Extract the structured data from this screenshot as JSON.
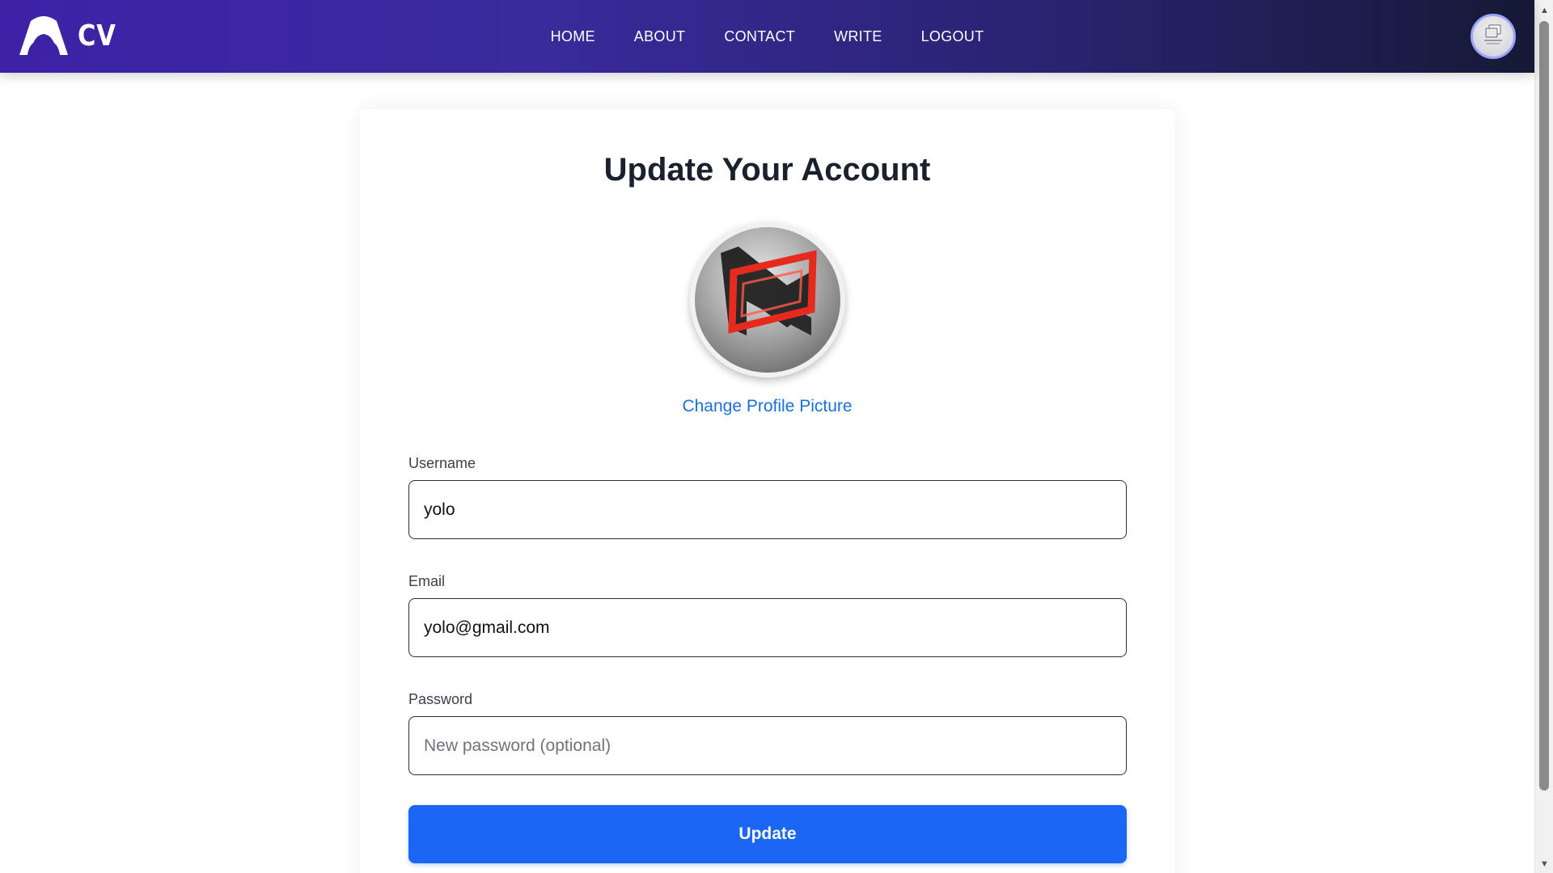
{
  "brand": {
    "name": "CV",
    "logo_icon": "arch-logo-icon"
  },
  "nav": {
    "items": [
      {
        "label": "HOME"
      },
      {
        "label": "ABOUT"
      },
      {
        "label": "CONTACT"
      },
      {
        "label": "WRITE"
      },
      {
        "label": "LOGOUT"
      }
    ],
    "avatar_icon": "no-image-avatar-icon"
  },
  "form": {
    "title": "Update Your Account",
    "change_picture_label": "Change Profile Picture",
    "username": {
      "label": "Username",
      "value": "yolo"
    },
    "email": {
      "label": "Email",
      "value": "yolo@gmail.com"
    },
    "password": {
      "label": "Password",
      "value": "",
      "placeholder": "New password (optional)"
    },
    "submit_label": "Update"
  },
  "colors": {
    "nav_gradient_start": "#3d22a8",
    "nav_gradient_end": "#141a36",
    "accent": "#1a66f5",
    "link": "#1c6fe0"
  }
}
